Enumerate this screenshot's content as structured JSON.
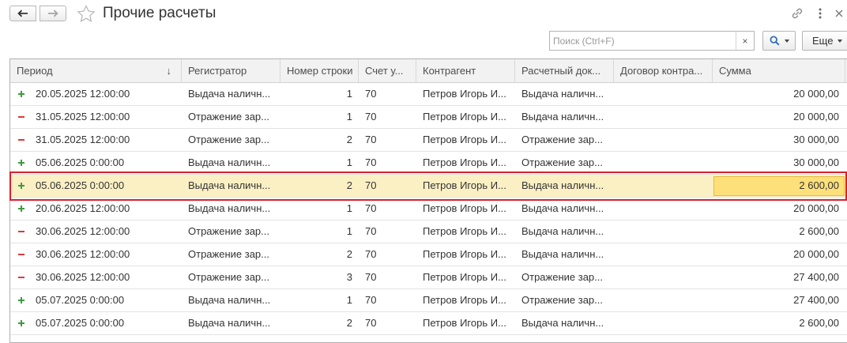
{
  "window": {
    "title": "Прочие расчеты"
  },
  "search": {
    "placeholder": "Поиск (Ctrl+F)",
    "clear_label": "×",
    "more_label": "Еще"
  },
  "table": {
    "columns": [
      "Период",
      "Регистратор",
      "Номер строки",
      "Счет у...",
      "Контрагент",
      "Расчетный док...",
      "Договор контра...",
      "Сумма"
    ],
    "sort_indicator": "↓",
    "rows": [
      {
        "sign": "plus",
        "period": "20.05.2025 12:00:00",
        "registrar": "Выдача наличн...",
        "line": "1",
        "account": "70",
        "counterparty": "Петров Игорь И...",
        "doc": "Выдача наличн...",
        "contract": "",
        "sum": "20 000,00",
        "selected": false
      },
      {
        "sign": "minus",
        "period": "31.05.2025 12:00:00",
        "registrar": "Отражение зар...",
        "line": "1",
        "account": "70",
        "counterparty": "Петров Игорь И...",
        "doc": "Выдача наличн...",
        "contract": "",
        "sum": "20 000,00",
        "selected": false
      },
      {
        "sign": "minus",
        "period": "31.05.2025 12:00:00",
        "registrar": "Отражение зар...",
        "line": "2",
        "account": "70",
        "counterparty": "Петров Игорь И...",
        "doc": "Отражение зар...",
        "contract": "",
        "sum": "30 000,00",
        "selected": false
      },
      {
        "sign": "plus",
        "period": "05.06.2025 0:00:00",
        "registrar": "Выдача наличн...",
        "line": "1",
        "account": "70",
        "counterparty": "Петров Игорь И...",
        "doc": "Отражение зар...",
        "contract": "",
        "sum": "30 000,00",
        "selected": false
      },
      {
        "sign": "plus",
        "period": "05.06.2025 0:00:00",
        "registrar": "Выдача наличн...",
        "line": "2",
        "account": "70",
        "counterparty": "Петров Игорь И...",
        "doc": "Выдача наличн...",
        "contract": "",
        "sum": "2 600,00",
        "selected": true
      },
      {
        "sign": "plus",
        "period": "20.06.2025 12:00:00",
        "registrar": "Выдача наличн...",
        "line": "1",
        "account": "70",
        "counterparty": "Петров Игорь И...",
        "doc": "Выдача наличн...",
        "contract": "",
        "sum": "20 000,00",
        "selected": false
      },
      {
        "sign": "minus",
        "period": "30.06.2025 12:00:00",
        "registrar": "Отражение зар...",
        "line": "1",
        "account": "70",
        "counterparty": "Петров Игорь И...",
        "doc": "Выдача наличн...",
        "contract": "",
        "sum": "2 600,00",
        "selected": false
      },
      {
        "sign": "minus",
        "period": "30.06.2025 12:00:00",
        "registrar": "Отражение зар...",
        "line": "2",
        "account": "70",
        "counterparty": "Петров Игорь И...",
        "doc": "Выдача наличн...",
        "contract": "",
        "sum": "20 000,00",
        "selected": false
      },
      {
        "sign": "minus",
        "period": "30.06.2025 12:00:00",
        "registrar": "Отражение зар...",
        "line": "3",
        "account": "70",
        "counterparty": "Петров Игорь И...",
        "doc": "Отражение зар...",
        "contract": "",
        "sum": "27 400,00",
        "selected": false
      },
      {
        "sign": "plus",
        "period": "05.07.2025 0:00:00",
        "registrar": "Выдача наличн...",
        "line": "1",
        "account": "70",
        "counterparty": "Петров Игорь И...",
        "doc": "Отражение зар...",
        "contract": "",
        "sum": "27 400,00",
        "selected": false
      },
      {
        "sign": "plus",
        "period": "05.07.2025 0:00:00",
        "registrar": "Выдача наличн...",
        "line": "2",
        "account": "70",
        "counterparty": "Петров Игорь И...",
        "doc": "Выдача наличн...",
        "contract": "",
        "sum": "2 600,00",
        "selected": false
      }
    ]
  },
  "colors": {
    "plus": "#3f9b3f",
    "minus": "#d83b3b",
    "selected_row": "#fbf0c4",
    "focused_cell": "#fde07a",
    "highlight_border": "#d9202e"
  },
  "icons": {
    "back": "arrow-left-icon",
    "forward": "arrow-right-icon",
    "favorite": "star-icon",
    "link": "link-icon",
    "more": "vertical-dots-icon",
    "close": "close-icon",
    "search": "search-icon",
    "plus": "plus-icon",
    "minus": "minus-icon"
  }
}
